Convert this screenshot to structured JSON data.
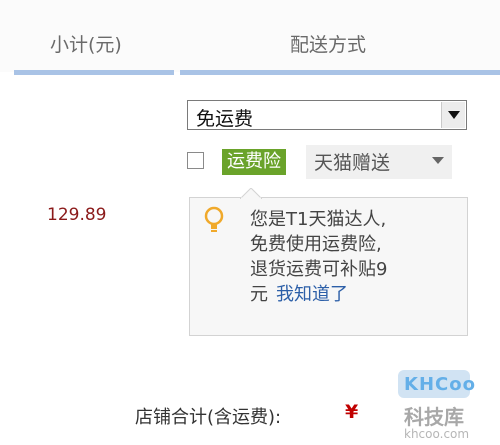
{
  "table_header": {
    "subtotal_label": "小计(元)",
    "shipping_label": "配送方式"
  },
  "row": {
    "price": "129.89",
    "shipping_select": {
      "value": "免运费"
    },
    "insurance": {
      "checked": false,
      "tag": "运费险",
      "gift_label": "天猫赠送"
    },
    "tooltip": {
      "lines": [
        "您是T1天猫达人,",
        "免费使用运费险,",
        "退货运费可补贴9",
        "元"
      ],
      "link": "我知道了"
    }
  },
  "footer": {
    "total_label": "店铺合计(含运费):",
    "currency": "¥"
  },
  "watermark": {
    "logo": "KHCoo",
    "name": "科技库",
    "url": "khcoo.com"
  },
  "colors": {
    "header_bar": "#a9c3e6",
    "price": "#8b1a1a",
    "tag_bg": "#6aa32a",
    "link": "#2c5fa8",
    "currency": "#c00000"
  },
  "icons": {
    "select_arrow": "triangle-down-icon",
    "gift_arrow": "chevron-down-icon",
    "tip": "lightbulb-icon"
  }
}
